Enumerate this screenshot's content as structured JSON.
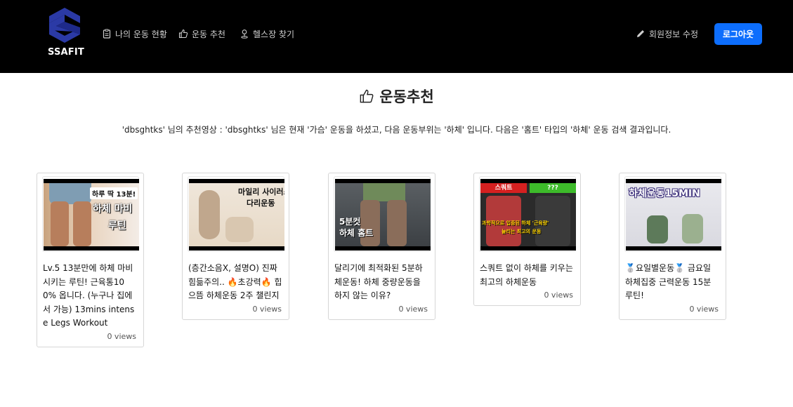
{
  "brand": {
    "name": "SSAFIT",
    "color": "#2b3aa6"
  },
  "nav": {
    "items": [
      {
        "label": "나의 운동 현황",
        "icon": "clipboard-icon"
      },
      {
        "label": "운동 추천",
        "icon": "thumbs-up-icon"
      },
      {
        "label": "헬스장 찾기",
        "icon": "person-pin-icon"
      }
    ],
    "edit_profile": {
      "label": "회원정보 수정",
      "icon": "pencil-icon"
    },
    "logout_label": "로그아웃"
  },
  "page": {
    "title": "운동추천",
    "title_icon": "thumbs-up-icon",
    "description": "'dbsghtks' 님의 추천영상 : 'dbsghtks' 님은 현재 '가슴' 운동을 하셨고, 다음 운동부위는 '하체' 입니다. 다음은 '홈트' 타입의 '하체' 운동 검색 결과입니다."
  },
  "videos": [
    {
      "title": "Lv.5 13분만에 하체 마비시키는 루틴! 근육통100% 옵니다. (누구나 집에서 가능) 13mins intense Legs Workout",
      "views": "0 views",
      "thumb_text": [
        "하루 딱 13분!",
        "하체 마비",
        "루틴"
      ]
    },
    {
      "title": "(층간소음X, 설명O) 진짜 힘듦주의.. 🔥초강력🔥 힙으뜸 하체운동 2주 챌린지",
      "views": "0 views",
      "thumb_text": [
        "마일리 사이러스",
        "다리운동"
      ]
    },
    {
      "title": "달리기에 최적화된 5분하체운동! 하체 중량운동을 하지 않는 이유?",
      "views": "0 views",
      "thumb_text": [
        "5분컷",
        "하체 홈트"
      ]
    },
    {
      "title": "스쿼트 없이 하체를 키우는 최고의 하체운동",
      "views": "0 views",
      "thumb_text": [
        "스쿼트",
        "???",
        "과학적으로 입증된 하체 '근육량'",
        "늘리는 최고의 운동"
      ]
    },
    {
      "title": "🥈요일별운동🥈 금요일 하체집중 근력운동 15분 루틴!",
      "views": "0 views",
      "thumb_text": [
        "하체운동15MIN"
      ]
    }
  ]
}
